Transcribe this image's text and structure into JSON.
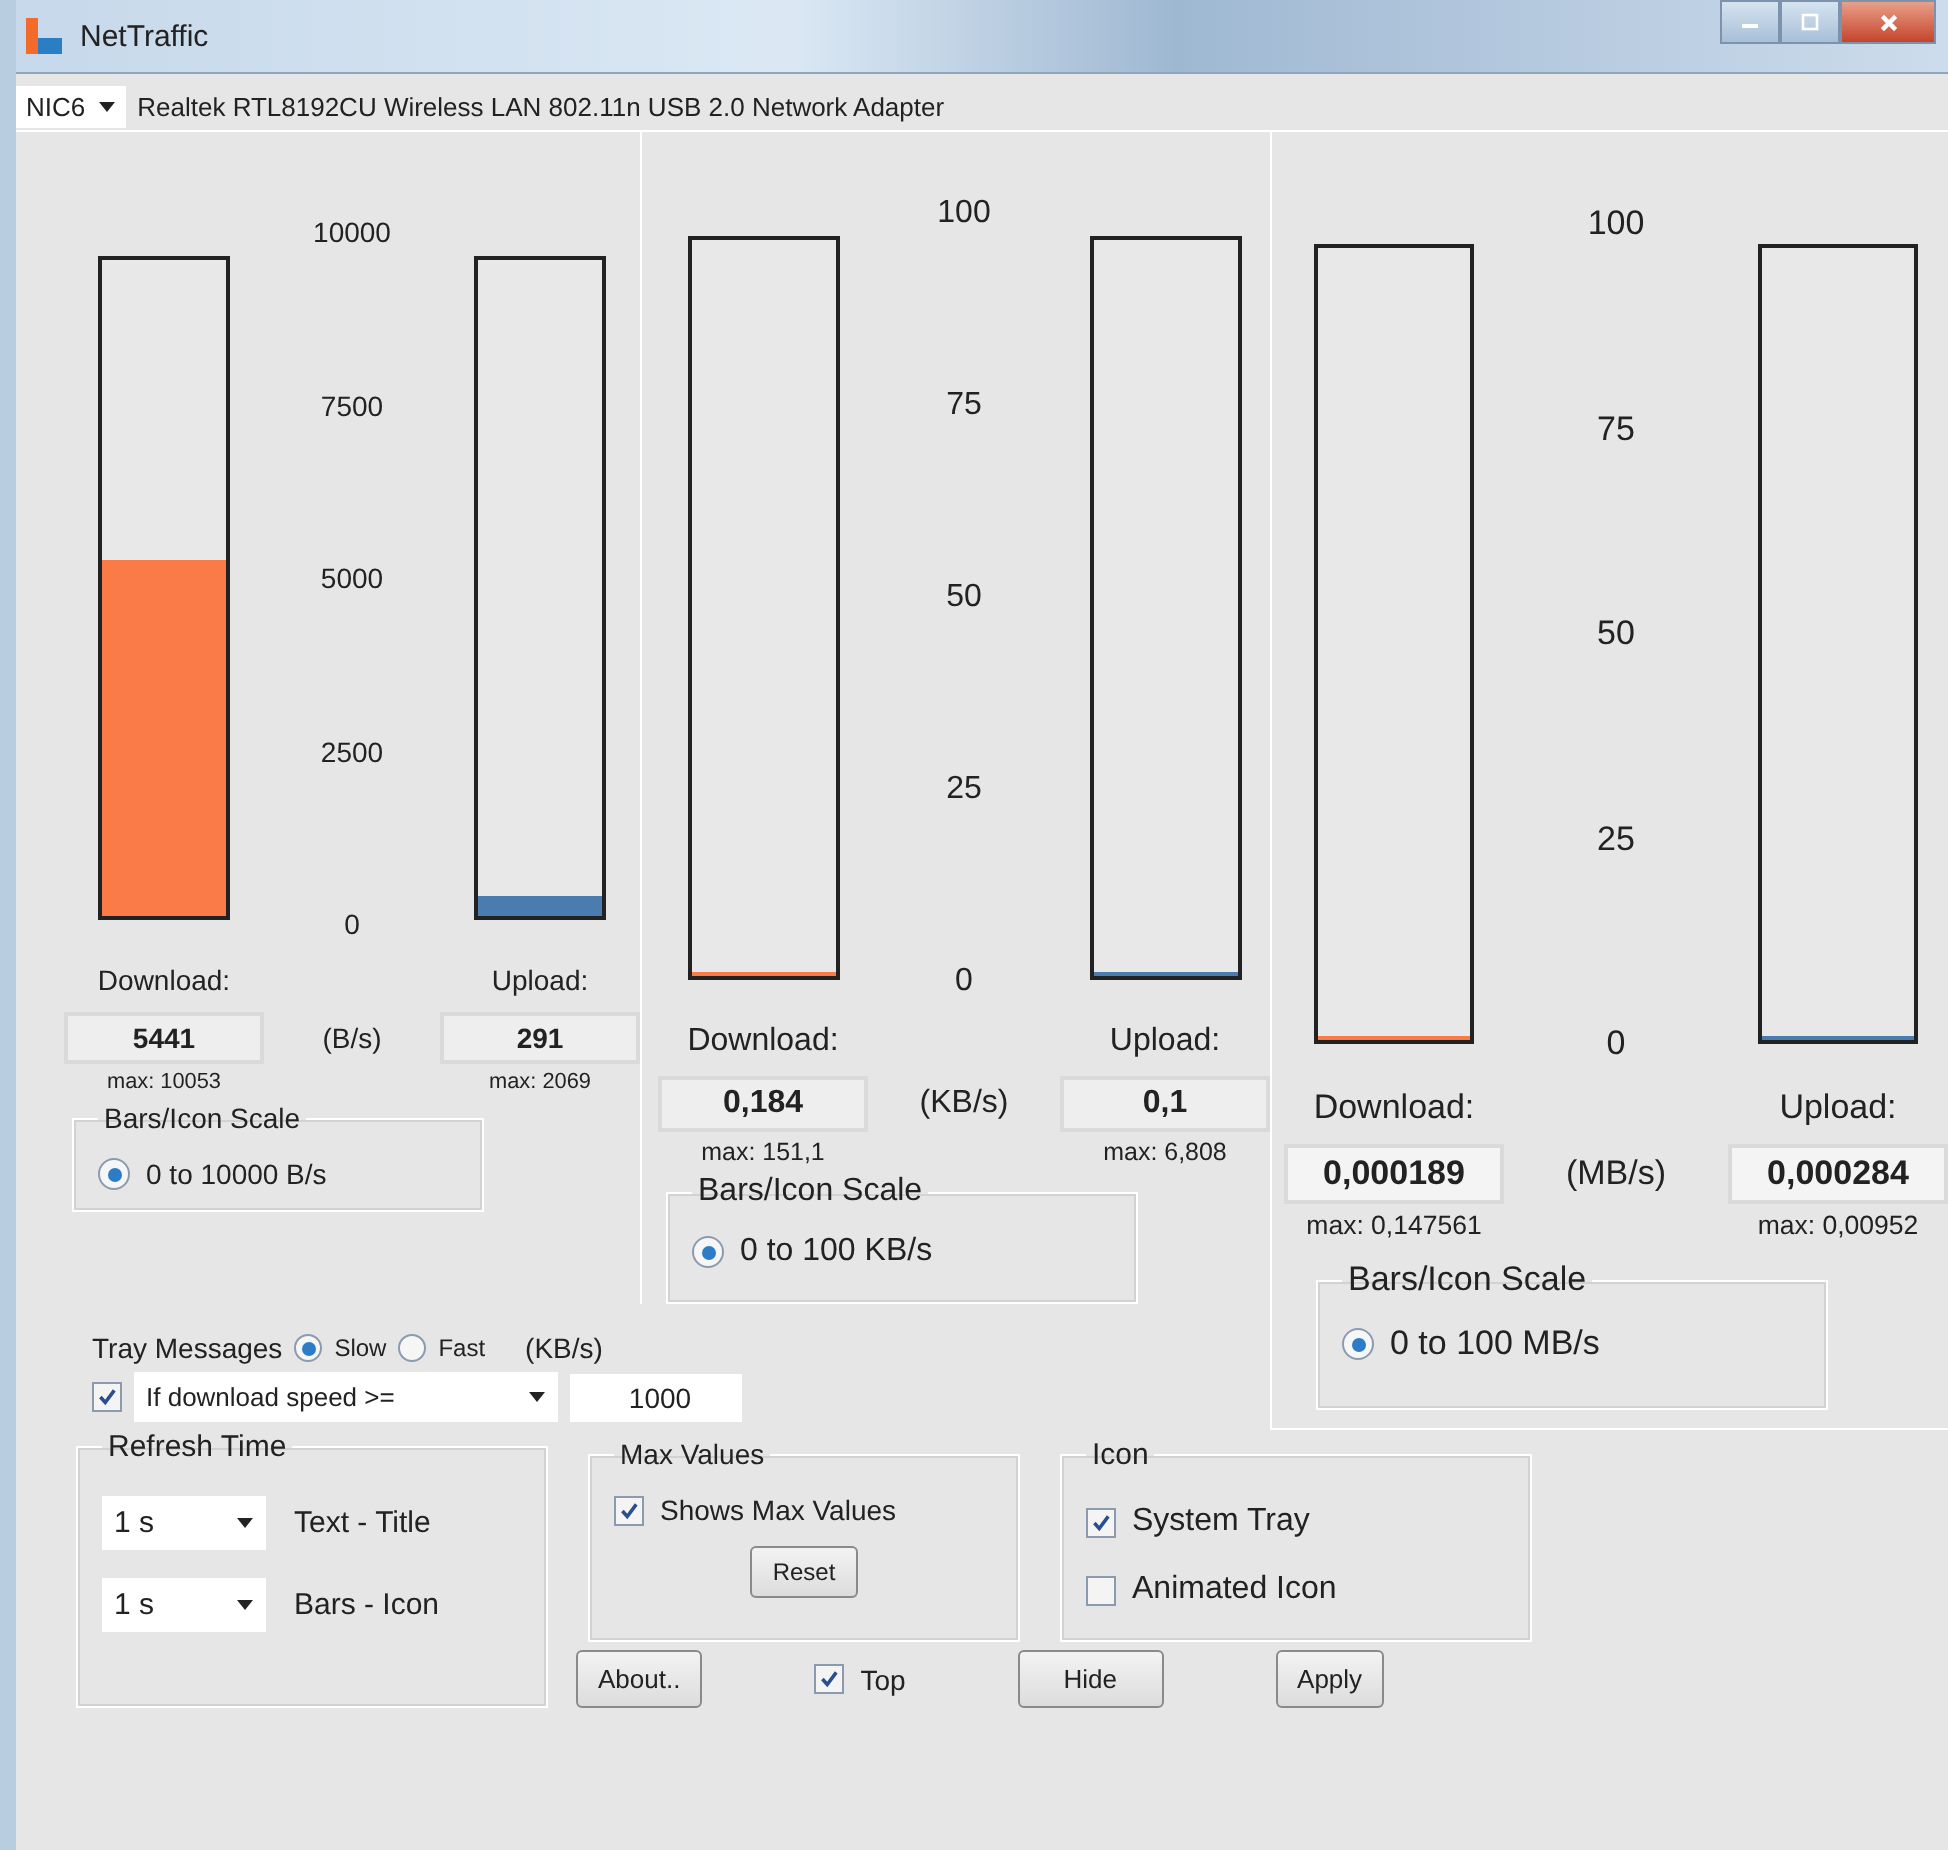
{
  "window": {
    "title": "NetTraffic"
  },
  "adapter": {
    "nic": "NIC6",
    "name": "Realtek RTL8192CU Wireless LAN 802.11n USB 2.0 Network Adapter"
  },
  "panels": [
    {
      "ticks": [
        "10000",
        "7500",
        "5000",
        "2500",
        "0"
      ],
      "unit": "(B/s)",
      "download": {
        "label": "Download:",
        "value": "5441",
        "max": "max: 10053",
        "level": 0.544
      },
      "upload": {
        "label": "Upload:",
        "value": "291",
        "max": "max: 2069",
        "level": 0.03
      },
      "scale": {
        "title": "Bars/Icon Scale",
        "option": "0 to 10000 B/s",
        "selected": true
      }
    },
    {
      "ticks": [
        "100",
        "75",
        "50",
        "25",
        "0"
      ],
      "unit": "(KB/s)",
      "download": {
        "label": "Download:",
        "value": "0,184",
        "max": "max: 151,1",
        "level": 0.0018
      },
      "upload": {
        "label": "Upload:",
        "value": "0,1",
        "max": "max: 6,808",
        "level": 0.001
      },
      "scale": {
        "title": "Bars/Icon Scale",
        "option": "0 to 100 KB/s",
        "selected": true
      }
    },
    {
      "ticks": [
        "100",
        "75",
        "50",
        "25",
        "0"
      ],
      "unit": "(MB/s)",
      "download": {
        "label": "Download:",
        "value": "0,000189",
        "max": "max: 0,147561",
        "level": 2e-06
      },
      "upload": {
        "label": "Upload:",
        "value": "0,000284",
        "max": "max: 0,00952",
        "level": 3e-06
      },
      "scale": {
        "title": "Bars/Icon Scale",
        "option": "0 to 100 MB/s",
        "selected": true
      }
    }
  ],
  "tray": {
    "label": "Tray Messages",
    "options": [
      {
        "label": "Slow",
        "selected": true
      },
      {
        "label": "Fast",
        "selected": false
      }
    ],
    "unit": "(KB/s)",
    "enabled": true,
    "condition": "If download speed >=",
    "threshold": "1000"
  },
  "refresh": {
    "title": "Refresh Time",
    "rows": [
      {
        "value": "1 s",
        "label": "Text - Title"
      },
      {
        "value": "1 s",
        "label": "Bars - Icon"
      }
    ]
  },
  "max_values": {
    "title": "Max Values",
    "label": "Shows Max Values",
    "checked": true,
    "reset": "Reset"
  },
  "icon": {
    "title": "Icon",
    "options": [
      {
        "label": "System Tray",
        "checked": true
      },
      {
        "label": "Animated Icon",
        "checked": false
      }
    ]
  },
  "footer": {
    "about": "About..",
    "top": {
      "label": "Top",
      "checked": true
    },
    "hide": "Hide",
    "apply": "Apply"
  }
}
